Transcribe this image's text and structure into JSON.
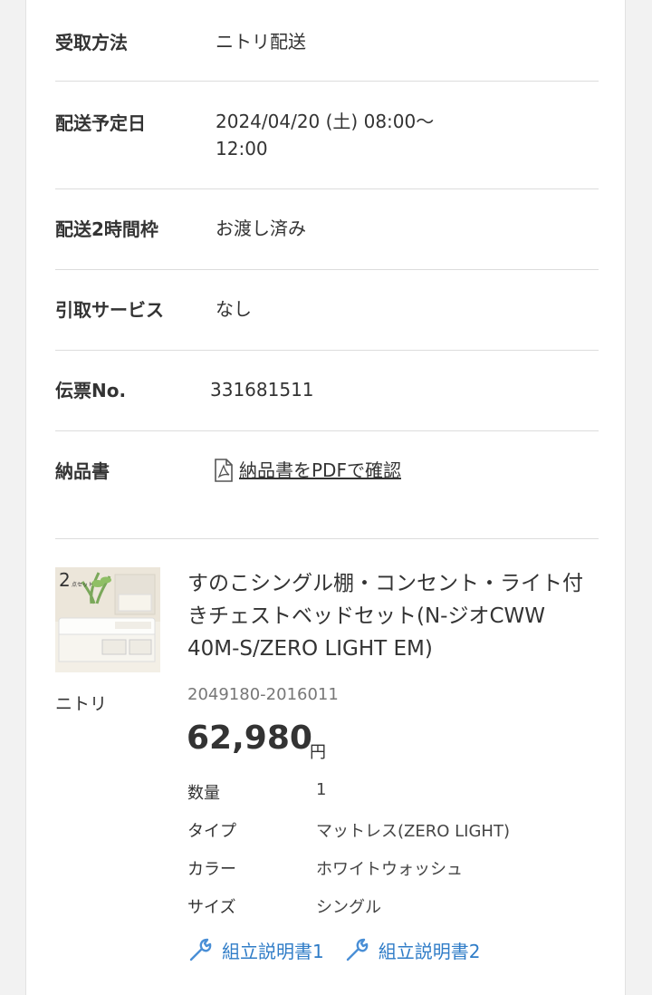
{
  "rows": [
    {
      "label": "受取方法",
      "value": "ニトリ配送"
    },
    {
      "label": "配送予定日",
      "value_line1": "2024/04/20 (土) 08:00〜",
      "value_line2": "12:00"
    },
    {
      "label": "配送2時間枠",
      "value": "お渡し済み"
    },
    {
      "label": "引取サービス",
      "value": "なし"
    },
    {
      "label": "伝票No.",
      "value": "331681511"
    },
    {
      "label": "納品書",
      "link": "納品書をPDFで確認"
    }
  ],
  "product": {
    "thumb_badge": "2",
    "thumb_badge_sub": "点セット",
    "brand": "ニトリ",
    "title": "すのこシングル棚・コンセント・ライト付きチェストベッドセット(N-ジオCWW 40M-S/ZERO LIGHT EM)",
    "code": "2049180-2016011",
    "price": "62,980",
    "currency": "円",
    "specs": [
      {
        "key": "数量",
        "value": "1"
      },
      {
        "key": "タイプ",
        "value": "マットレス(ZERO LIGHT)"
      },
      {
        "key": "カラー",
        "value": "ホワイトウォッシュ"
      },
      {
        "key": "サイズ",
        "value": "シングル"
      }
    ],
    "manuals": [
      "組立説明書1",
      "組立説明書2"
    ]
  },
  "colors": {
    "link_blue": "#2f7cc7",
    "divider": "#dcdcdc"
  },
  "icons": {
    "pdf": "pdf-file-icon",
    "manual": "wrench-icon"
  }
}
